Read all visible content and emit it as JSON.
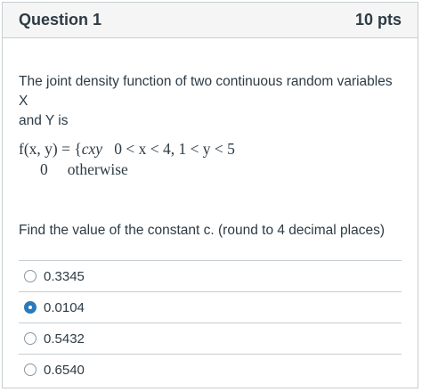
{
  "question": {
    "title": "Question 1",
    "points": "10 pts"
  },
  "prompt": {
    "line1": "The joint density function of two continuous random variables X",
    "line2": "and Y is",
    "math_row1_lhs": "f(x, y) = {",
    "math_row1_expr": "cxy",
    "math_row1_cond": "0 < x < 4,  1 < y < 5",
    "math_row2_val": "0",
    "math_row2_cond": "otherwise"
  },
  "instruction": "Find the value of the constant c. (round to 4 decimal places)",
  "answers": [
    {
      "label": "0.3345",
      "selected": false
    },
    {
      "label": "0.0104",
      "selected": true
    },
    {
      "label": "0.5432",
      "selected": false
    },
    {
      "label": "0.6540",
      "selected": false
    }
  ],
  "colors": {
    "accent": "#2b7abc",
    "text": "#2d3b45",
    "border": "#c7cdd1",
    "header_bg": "#f5f5f5"
  }
}
